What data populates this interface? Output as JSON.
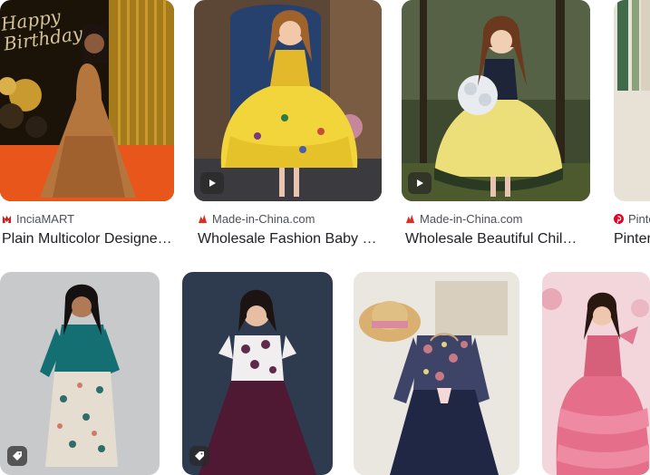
{
  "results": [
    {
      "source": "InciaMART",
      "title": "Plain Multicolor Designer Kids Gown",
      "has_video": false,
      "source_color": "#c5221f"
    },
    {
      "source": "Made-in-China.com",
      "title": "Wholesale Fashion Baby Girls Dress",
      "has_video": true,
      "source_color": "#d93025"
    },
    {
      "source": "Made-in-China.com",
      "title": "Wholesale Beautiful Children Dress",
      "has_video": true,
      "source_color": "#d93025"
    },
    {
      "source": "Pinterest",
      "title": "Pinterest",
      "has_video": false,
      "source_color": "#e60023"
    },
    {
      "source": "",
      "title": "",
      "has_tag": true
    },
    {
      "source": "",
      "title": "",
      "has_tag": true
    },
    {
      "source": "",
      "title": "",
      "has_tag": false
    },
    {
      "source": "",
      "title": "",
      "has_tag": false
    }
  ],
  "overlays": {
    "birthday_sign": "Happy Birthday"
  },
  "icons": {
    "play": "play-icon",
    "tag": "tag-icon"
  }
}
